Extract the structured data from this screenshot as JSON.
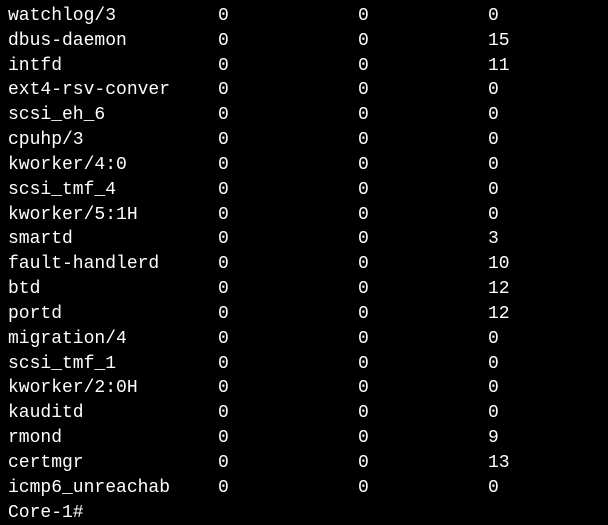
{
  "processes": [
    {
      "name": "watchlog/3",
      "v1": "0",
      "v2": "0",
      "v3": "0"
    },
    {
      "name": "dbus-daemon",
      "v1": "0",
      "v2": "0",
      "v3": "15"
    },
    {
      "name": "intfd",
      "v1": "0",
      "v2": "0",
      "v3": "11"
    },
    {
      "name": "ext4-rsv-conver",
      "v1": "0",
      "v2": "0",
      "v3": "0"
    },
    {
      "name": "scsi_eh_6",
      "v1": "0",
      "v2": "0",
      "v3": "0"
    },
    {
      "name": "cpuhp/3",
      "v1": "0",
      "v2": "0",
      "v3": "0"
    },
    {
      "name": "kworker/4:0",
      "v1": "0",
      "v2": "0",
      "v3": "0"
    },
    {
      "name": "scsi_tmf_4",
      "v1": "0",
      "v2": "0",
      "v3": "0"
    },
    {
      "name": "kworker/5:1H",
      "v1": "0",
      "v2": "0",
      "v3": "0"
    },
    {
      "name": "smartd",
      "v1": "0",
      "v2": "0",
      "v3": "3"
    },
    {
      "name": "fault-handlerd",
      "v1": "0",
      "v2": "0",
      "v3": "10"
    },
    {
      "name": "btd",
      "v1": "0",
      "v2": "0",
      "v3": "12"
    },
    {
      "name": "portd",
      "v1": "0",
      "v2": "0",
      "v3": "12"
    },
    {
      "name": "migration/4",
      "v1": "0",
      "v2": "0",
      "v3": "0"
    },
    {
      "name": "scsi_tmf_1",
      "v1": "0",
      "v2": "0",
      "v3": "0"
    },
    {
      "name": "kworker/2:0H",
      "v1": "0",
      "v2": "0",
      "v3": "0"
    },
    {
      "name": "kauditd",
      "v1": "0",
      "v2": "0",
      "v3": "0"
    },
    {
      "name": "rmond",
      "v1": "0",
      "v2": "0",
      "v3": "9"
    },
    {
      "name": "certmgr",
      "v1": "0",
      "v2": "0",
      "v3": "13"
    },
    {
      "name": "icmp6_unreachab",
      "v1": "0",
      "v2": "0",
      "v3": "0"
    }
  ],
  "prompt": "Core-1#"
}
